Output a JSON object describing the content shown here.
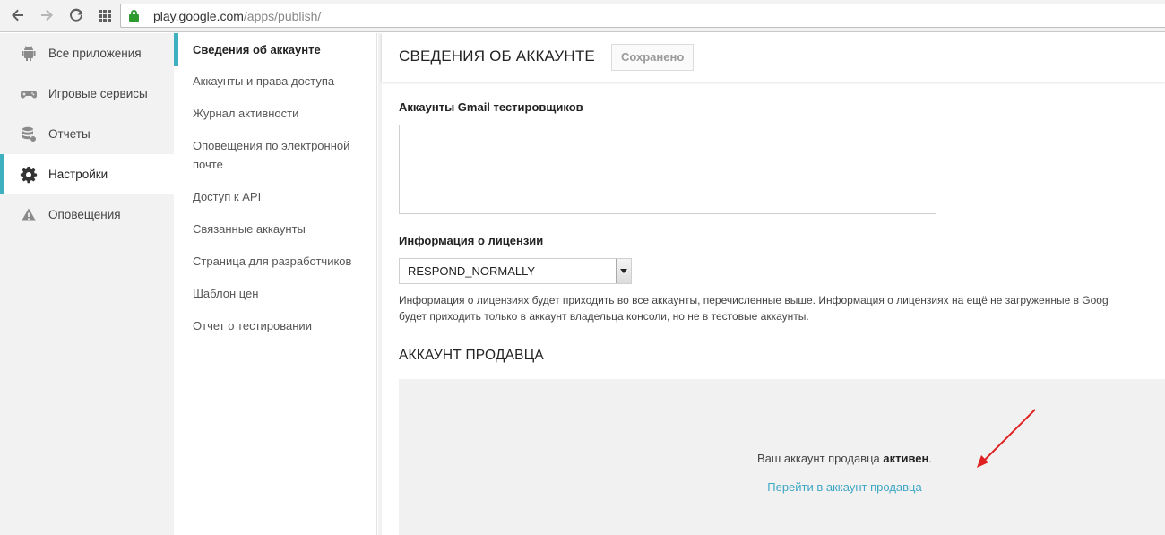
{
  "browser": {
    "back_icon": "arrow-left-icon",
    "forward_icon": "arrow-right-icon",
    "reload_icon": "reload-icon",
    "apps_icon": "apps-grid-icon",
    "lock_icon": "lock-icon",
    "url_host": "play.google.com",
    "url_path": "/apps/publish/"
  },
  "leftnav": {
    "items": [
      {
        "label": "Все приложения",
        "icon": "android-icon"
      },
      {
        "label": "Игровые сервисы",
        "icon": "gamepad-icon"
      },
      {
        "label": "Отчеты",
        "icon": "database-icon"
      },
      {
        "label": "Настройки",
        "icon": "gear-icon",
        "active": true
      },
      {
        "label": "Оповещения",
        "icon": "warning-icon"
      }
    ]
  },
  "subnav": {
    "items": [
      {
        "label": "Сведения об аккаунте",
        "active": true
      },
      {
        "label": "Аккаунты и права доступа"
      },
      {
        "label": "Журнал активности"
      },
      {
        "label": "Оповещения по электронной почте"
      },
      {
        "label": "Доступ к API"
      },
      {
        "label": "Связанные аккаунты"
      },
      {
        "label": "Страница для разработчиков"
      },
      {
        "label": "Шаблон цен"
      },
      {
        "label": "Отчет о тестировании"
      }
    ]
  },
  "main": {
    "title": "СВЕДЕНИЯ ОБ АККАУНТЕ",
    "saved_label": "Сохранено",
    "gmail_label": "Аккаунты Gmail тестировщиков",
    "gmail_value": "",
    "license_label": "Информация о лицензии",
    "license_value": "RESPOND_NORMALLY",
    "help_line1": "Информация о лицензиях будет приходить во все аккаунты, перечисленные выше. Информация о лицензиях на ещё не загруженные в Goog",
    "help_line2": "будет приходить только в аккаунт владельца консоли, но не в тестовые аккаунты.",
    "seller_section_title": "АККАУНТ ПРОДАВЦА",
    "seller_status_prefix": "Ваш аккаунт продавца ",
    "seller_status_bold": "активен",
    "seller_status_suffix": ".",
    "seller_link": "Перейти в аккаунт продавца"
  },
  "colors": {
    "accent": "#3fb0bf",
    "link": "#3fa7c4",
    "annotation_arrow": "#e02020"
  }
}
